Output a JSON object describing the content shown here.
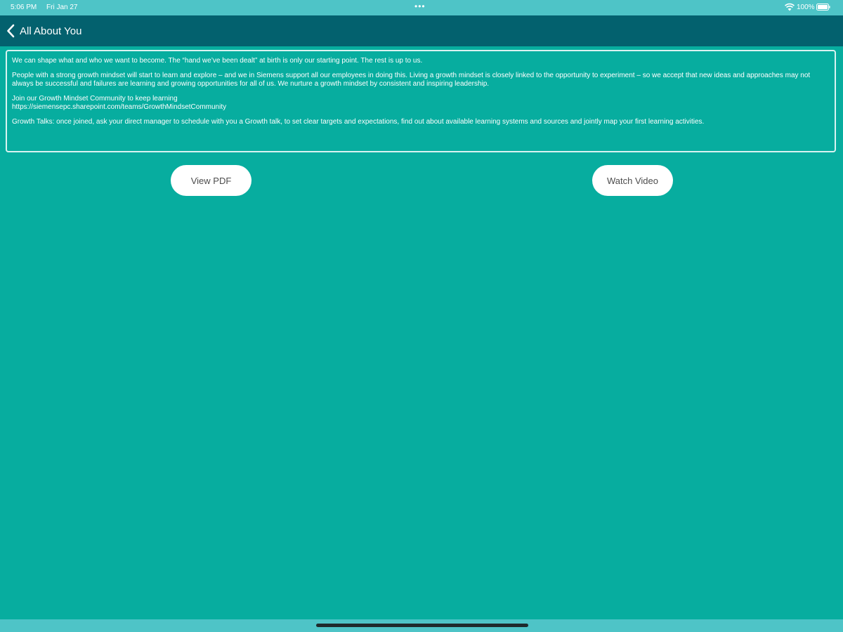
{
  "status_bar": {
    "time": "5:06 PM",
    "date": "Fri Jan 27",
    "multitask_dots": "•••",
    "battery_percent": "100%"
  },
  "nav": {
    "title": "All About You",
    "back_icon": "chevron-left-icon"
  },
  "content": {
    "paragraph_1": "We can shape what and who we want to become. The “hand we’ve been dealt” at birth is only our starting point. The rest is up to us.",
    "paragraph_2": "People with a strong growth mindset will start to learn and explore – and we in Siemens support all our employees in doing this. Living a growth mindset is closely linked to the opportunity to experiment – so we accept that new ideas and approaches may not always be successful and failures are learning and growing opportunities for all of us. We nurture a growth mindset by consistent and inspiring leadership.",
    "community_line": "Join our Growth Mindset Community to keep learning",
    "community_url": "https://siemensepc.sharepoint.com/teams/GrowthMindsetCommunity",
    "paragraph_3": "Growth Talks: once joined, ask your direct manager to schedule with you a Growth talk, to set clear targets and expectations, find out about available learning systems and sources and jointly map your first learning activities."
  },
  "buttons": {
    "view_pdf": "View PDF",
    "watch_video": "Watch Video"
  },
  "colors": {
    "background": "#07ad9f",
    "nav_bar": "#03616e",
    "status_bar": "#4ec4c7",
    "button_bg": "#ffffff",
    "button_text": "#4c4c4c"
  }
}
